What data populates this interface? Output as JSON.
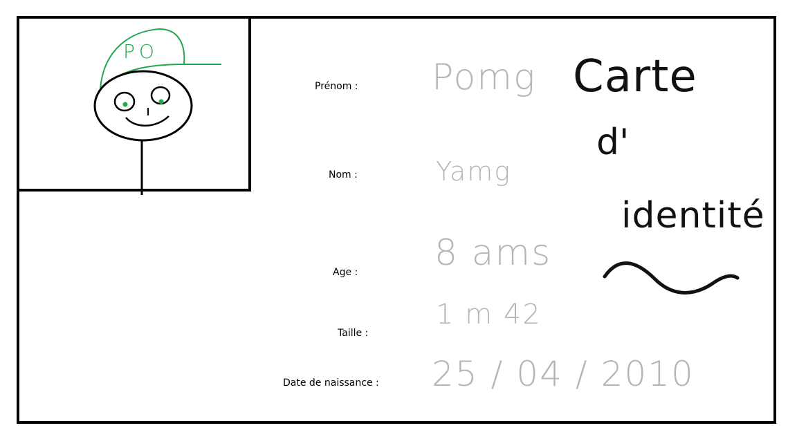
{
  "card": {
    "fields": [
      {
        "label": "Prénom :",
        "value": "Pomg"
      },
      {
        "label": "Nom :",
        "value": "Yamg"
      },
      {
        "label": "Age :",
        "value": "8 ams"
      },
      {
        "label": "Taille :",
        "value": "1 m 42"
      },
      {
        "label": "Date de naissance :",
        "value": "25 / 04 / 2010"
      }
    ],
    "title_lines": [
      "Carte",
      "d'",
      "identité"
    ],
    "cap_text": "PO"
  },
  "colors": {
    "cap": "#22a84a",
    "eyes": "#22a84a",
    "handwriting": "#b5b5b5",
    "title": "#111111",
    "border": "#000000"
  }
}
